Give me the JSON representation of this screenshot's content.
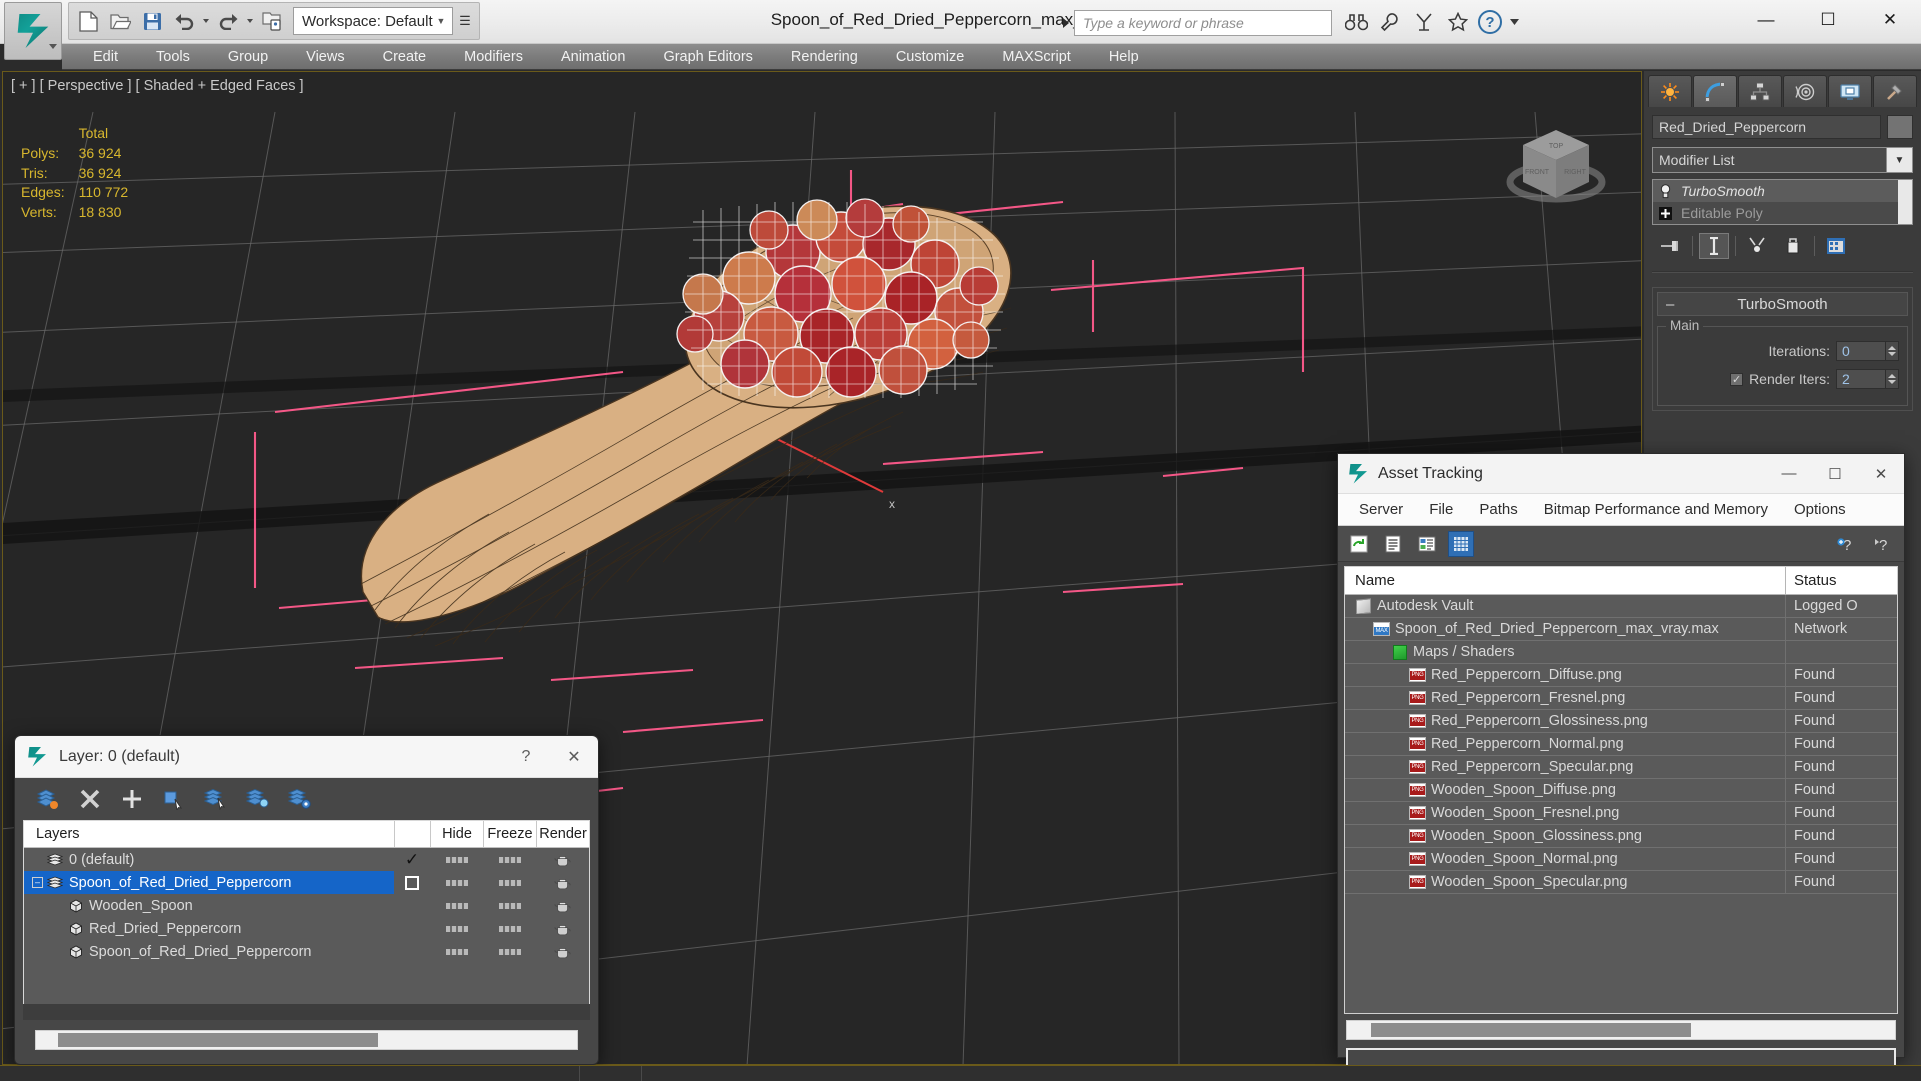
{
  "titlebar": {
    "document_title": "Spoon_of_Red_Dried_Peppercorn_max_vray.max",
    "workspace_label": "Workspace: Default",
    "search_placeholder": "Type a keyword or phrase",
    "quick_access": [
      {
        "name": "new-file",
        "label": "New"
      },
      {
        "name": "open-file",
        "label": "Open"
      },
      {
        "name": "save-file",
        "label": "Save"
      },
      {
        "name": "undo",
        "label": "Undo"
      },
      {
        "name": "redo",
        "label": "Redo"
      },
      {
        "name": "set-project-folder",
        "label": "Set Project Folder"
      }
    ],
    "title_icons": [
      "binoculars-icon",
      "wrench-icon",
      "mask-icon",
      "star-icon",
      "help-icon"
    ],
    "window_buttons": {
      "minimize": "—",
      "maximize": "☐",
      "close": "✕"
    }
  },
  "menubar": {
    "items": [
      "Edit",
      "Tools",
      "Group",
      "Views",
      "Create",
      "Modifiers",
      "Animation",
      "Graph Editors",
      "Rendering",
      "Customize",
      "MAXScript",
      "Help"
    ]
  },
  "viewport": {
    "label": "[ + ] [ Perspective ] [ Shaded + Edged Faces ]",
    "stats": {
      "header": "Total",
      "rows": [
        {
          "key": "Polys:",
          "value": "36 924"
        },
        {
          "key": "Tris:",
          "value": "36 924"
        },
        {
          "key": "Edges:",
          "value": "110 772"
        },
        {
          "key": "Verts:",
          "value": "18 830"
        }
      ]
    },
    "viewcube_faces": {
      "top": "TOP",
      "front": "FRONT",
      "right": "RIGHT"
    },
    "colors": {
      "background": "#262626",
      "grid": "#6e6e6e",
      "wood": "#d8b183",
      "peppercorn_red": "#b01f22",
      "peppercorn_light": "#f2ecec",
      "helper_pink": "#ff5a8c",
      "axis_red": "#e03a3a"
    }
  },
  "command_panel": {
    "tabs": [
      {
        "name": "create-tab",
        "icon": "star-burst-icon",
        "active": false
      },
      {
        "name": "modify-tab",
        "icon": "bent-arc-icon",
        "active": true
      },
      {
        "name": "hierarchy-tab",
        "icon": "hierarchy-icon",
        "active": false
      },
      {
        "name": "motion-tab",
        "icon": "motion-wheel-icon",
        "active": false
      },
      {
        "name": "display-tab",
        "icon": "monitor-icon",
        "active": false
      },
      {
        "name": "utilities-tab",
        "icon": "hammer-icon",
        "active": false
      }
    ],
    "object_name": "Red_Dried_Peppercorn",
    "modifier_list_label": "Modifier List",
    "stack": [
      {
        "label": "TurboSmooth",
        "selected": true
      },
      {
        "label": "Editable Poly",
        "selected": false
      }
    ],
    "stack_buttons": [
      "pin-stack-icon",
      "show-end-result-icon",
      "make-unique-icon",
      "remove-modifier-icon",
      "configure-modifier-sets-icon"
    ],
    "rollout": {
      "title": "TurboSmooth",
      "collapse_symbol": "–",
      "group_title": "Main",
      "params": [
        {
          "label": "Iterations:",
          "value": "0",
          "checkbox": false
        },
        {
          "label": "Render Iters:",
          "value": "2",
          "checkbox": true
        }
      ]
    }
  },
  "asset_tracking": {
    "title": "Asset Tracking",
    "window_buttons": {
      "minimize": "—",
      "maximize": "☐",
      "close": "✕"
    },
    "menu": [
      "Server",
      "File",
      "Paths",
      "Bitmap Performance and Memory",
      "Options"
    ],
    "toolbar": [
      {
        "name": "refresh-button",
        "icon": "refresh-icon",
        "selected": false
      },
      {
        "name": "list-view-button",
        "icon": "list-icon",
        "selected": false
      },
      {
        "name": "detail-view-button",
        "icon": "detail-icon",
        "selected": false
      },
      {
        "name": "table-view-button",
        "icon": "table-icon",
        "selected": true
      }
    ],
    "toolbar_right": [
      {
        "name": "help-add-button",
        "icon": "help-plus-icon"
      },
      {
        "name": "help-button",
        "icon": "help-question-icon"
      }
    ],
    "columns": [
      "Name",
      "Status"
    ],
    "rows": [
      {
        "name": "Autodesk Vault",
        "status": "Logged O",
        "icon": "vault-icon",
        "indent": 1
      },
      {
        "name": "Spoon_of_Red_Dried_Peppercorn_max_vray.max",
        "status": "Network",
        "icon": "max-file-icon",
        "indent": 2
      },
      {
        "name": "Maps / Shaders",
        "status": "",
        "icon": "maps-shaders-icon",
        "indent": 3
      },
      {
        "name": "Red_Peppercorn_Diffuse.png",
        "status": "Found",
        "icon": "png-icon",
        "indent": 4
      },
      {
        "name": "Red_Peppercorn_Fresnel.png",
        "status": "Found",
        "icon": "png-icon",
        "indent": 4
      },
      {
        "name": "Red_Peppercorn_Glossiness.png",
        "status": "Found",
        "icon": "png-icon",
        "indent": 4
      },
      {
        "name": "Red_Peppercorn_Normal.png",
        "status": "Found",
        "icon": "png-icon",
        "indent": 4
      },
      {
        "name": "Red_Peppercorn_Specular.png",
        "status": "Found",
        "icon": "png-icon",
        "indent": 4
      },
      {
        "name": "Wooden_Spoon_Diffuse.png",
        "status": "Found",
        "icon": "png-icon",
        "indent": 4
      },
      {
        "name": "Wooden_Spoon_Fresnel.png",
        "status": "Found",
        "icon": "png-icon",
        "indent": 4
      },
      {
        "name": "Wooden_Spoon_Glossiness.png",
        "status": "Found",
        "icon": "png-icon",
        "indent": 4
      },
      {
        "name": "Wooden_Spoon_Normal.png",
        "status": "Found",
        "icon": "png-icon",
        "indent": 4
      },
      {
        "name": "Wooden_Spoon_Specular.png",
        "status": "Found",
        "icon": "png-icon",
        "indent": 4
      }
    ]
  },
  "layer_dialog": {
    "title": "Layer: 0 (default)",
    "help_button": "?",
    "close_button": "✕",
    "toolbar": [
      {
        "name": "set-current-layer-button",
        "icon": "layers-current-icon"
      },
      {
        "name": "delete-layer-button",
        "icon": "delete-x-icon"
      },
      {
        "name": "new-layer-button",
        "icon": "plus-icon"
      },
      {
        "name": "add-selection-button",
        "icon": "add-object-icon"
      },
      {
        "name": "select-objects-button",
        "icon": "select-layer-icon"
      },
      {
        "name": "highlight-button",
        "icon": "layer-highlight-icon"
      },
      {
        "name": "layer-properties-button",
        "icon": "layer-settings-icon"
      }
    ],
    "columns": [
      "Layers",
      "Hide",
      "Freeze",
      "Render"
    ],
    "rows": [
      {
        "label": "0 (default)",
        "indent": 0,
        "expander": "",
        "selected": false,
        "current": "✓",
        "icon": "layer-stack-icon"
      },
      {
        "label": "Spoon_of_Red_Dried_Peppercorn",
        "indent": 0,
        "expander": "–",
        "selected": true,
        "current": "□",
        "icon": "layer-stack-icon"
      },
      {
        "label": "Wooden_Spoon",
        "indent": 1,
        "expander": "",
        "selected": false,
        "current": "",
        "icon": "object-box-icon"
      },
      {
        "label": "Red_Dried_Peppercorn",
        "indent": 1,
        "expander": "",
        "selected": false,
        "current": "",
        "icon": "object-box-icon"
      },
      {
        "label": "Spoon_of_Red_Dried_Peppercorn",
        "indent": 1,
        "expander": "",
        "selected": false,
        "current": "",
        "icon": "object-box-icon"
      }
    ]
  }
}
